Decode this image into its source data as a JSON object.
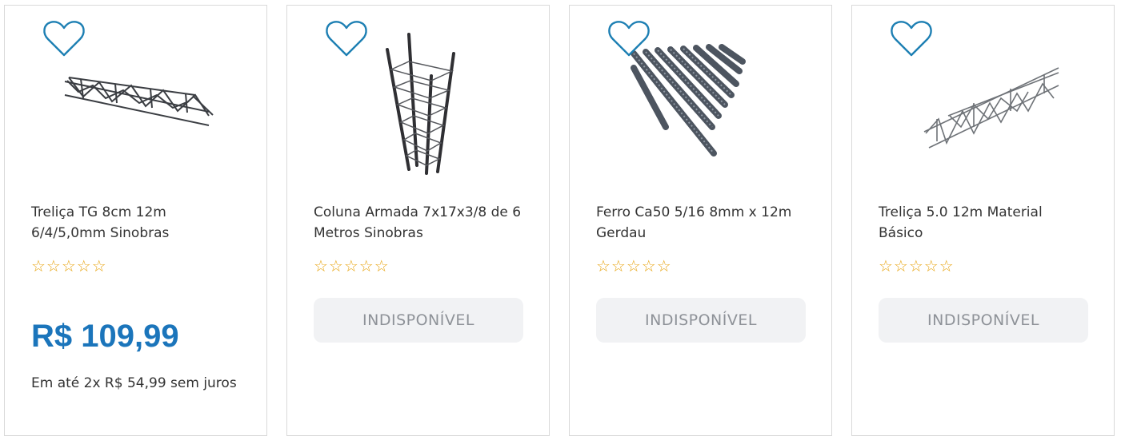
{
  "colors": {
    "accent": "#1b75bb",
    "heart": "#1d7fb3",
    "star": "#e8a616",
    "unavailable_bg": "#f1f2f4",
    "unavailable_text": "#8e9298",
    "card_border": "#d9d9d9"
  },
  "products": [
    {
      "name": "Treliça TG 8cm 12m 6/4/5,0mm Sinobras",
      "image_icon": "truss-beam-image",
      "rating_stars": "☆☆☆☆☆",
      "price": "R$ 109,99",
      "installments": "Em até 2x R$ 54,99 sem juros"
    },
    {
      "name": "Coluna Armada 7x17x3/8 de 6 Metros Sinobras",
      "image_icon": "rebar-column-image",
      "rating_stars": "☆☆☆☆☆",
      "button_label": "INDISPONÍVEL"
    },
    {
      "name": "Ferro Ca50 5/16 8mm x 12m Gerdau",
      "image_icon": "rebar-bundle-image",
      "rating_stars": "☆☆☆☆☆",
      "button_label": "INDISPONÍVEL"
    },
    {
      "name": "Treliça 5.0 12m Material Básico",
      "image_icon": "lattice-truss-image",
      "rating_stars": "☆☆☆☆☆",
      "button_label": "INDISPONÍVEL"
    }
  ]
}
